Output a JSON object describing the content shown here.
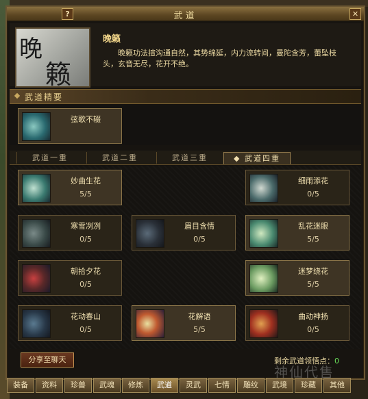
{
  "window": {
    "title": "武道"
  },
  "skill": {
    "name": "晚籁",
    "portrait_glyphs": [
      "晚",
      "籁"
    ],
    "description": "晚籁功法揎沟通自然，其势绵延，内力流转间，曼陀含芳，蕾坠枝头，玄音无尽，花开不绝。"
  },
  "essentials": {
    "label": "武道精要",
    "card": {
      "name": "弦歌不辍",
      "level": ""
    }
  },
  "tabs": [
    {
      "label": "武道一重"
    },
    {
      "label": "武道二重"
    },
    {
      "label": "武道三重"
    },
    {
      "label": "武道四重",
      "selected": true
    }
  ],
  "skills": [
    {
      "name": "妙曲生花",
      "level": "5/5",
      "active": true
    },
    {
      "name": "细雨添花",
      "level": "0/5",
      "active": false
    },
    {
      "name": "寒雪冽冽",
      "level": "0/5",
      "active": false
    },
    {
      "name": "眉目含情",
      "level": "0/5",
      "active": false
    },
    {
      "name": "乱花迷眼",
      "level": "5/5",
      "active": true
    },
    {
      "name": "朝拾夕花",
      "level": "0/5",
      "active": false
    },
    {
      "name": "迷梦绕花",
      "level": "5/5",
      "active": true
    },
    {
      "name": "花动春山",
      "level": "0/5",
      "active": false
    },
    {
      "name": "花解语",
      "level": "5/5",
      "active": true
    },
    {
      "name": "曲动神扬",
      "level": "0/5",
      "active": false
    }
  ],
  "footer": {
    "share_label": "分享至聊天",
    "remain_label": "剩余武道领悟点：",
    "remain_value": "0"
  },
  "bottom_tabs": [
    "装备",
    "资料",
    "珍兽",
    "武魂",
    "修炼",
    "武道",
    "灵武",
    "七情",
    "雕纹",
    "武境",
    "珍藏",
    "其他"
  ],
  "watermark": "神仙代售",
  "colors": {
    "accent": "#f2d68a",
    "highlight_green": "#6adf5a"
  }
}
